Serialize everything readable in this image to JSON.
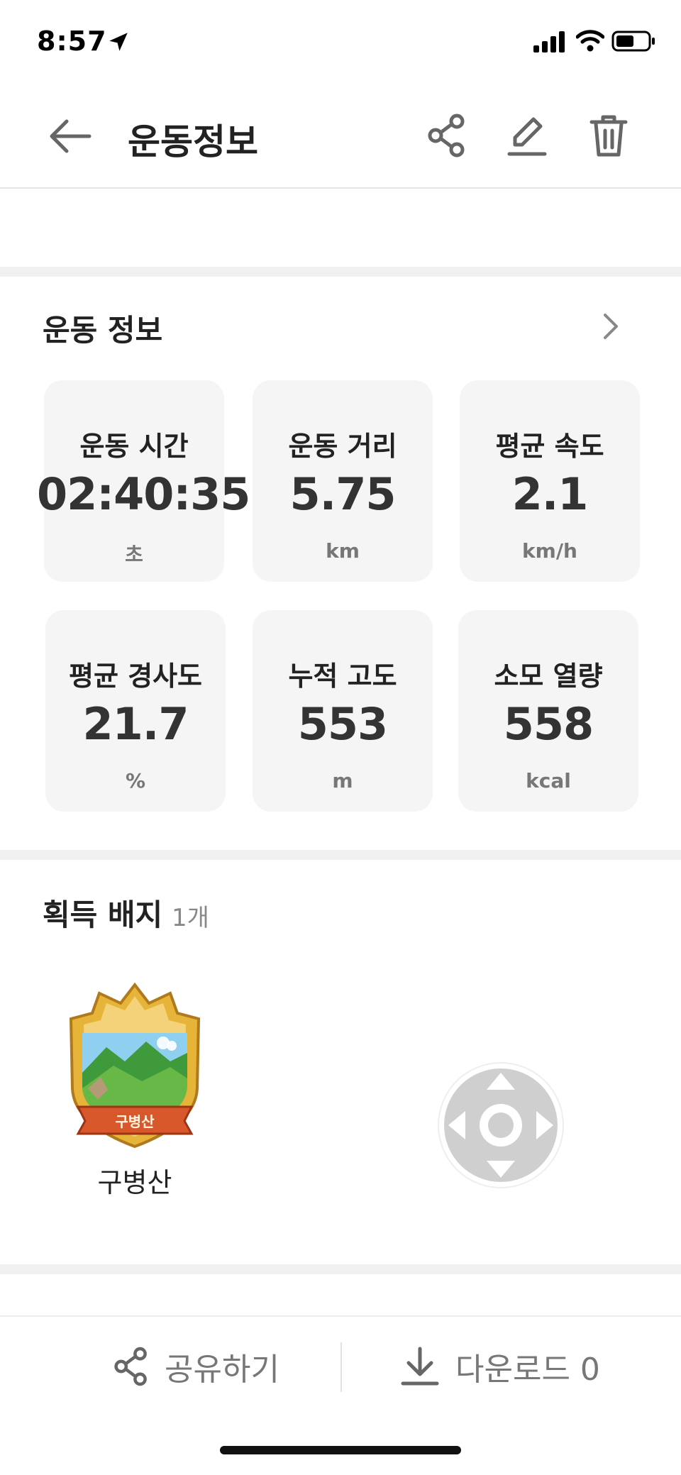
{
  "status_bar": {
    "time": "8:57"
  },
  "header": {
    "title": "운동정보"
  },
  "exercise_section": {
    "title": "운동 정보",
    "stats": [
      {
        "label": "운동 시간",
        "value": "02:40:35",
        "unit": "초"
      },
      {
        "label": "운동 거리",
        "value": "5.75",
        "unit": "km"
      },
      {
        "label": "평균 속도",
        "value": "2.1",
        "unit": "km/h"
      },
      {
        "label": "평균 경사도",
        "value": "21.7",
        "unit": "%"
      },
      {
        "label": "누적 고도",
        "value": "553",
        "unit": "m"
      },
      {
        "label": "소모 열량",
        "value": "558",
        "unit": "kcal"
      }
    ]
  },
  "badges_section": {
    "title": "획득 배지",
    "count": "1개",
    "badges": [
      {
        "name": "구병산",
        "ribbon_text": "구병산"
      }
    ]
  },
  "bottom_bar": {
    "share_label": "공유하기",
    "download_label": "다운로드 0"
  },
  "colors": {
    "card_background": "#f5f5f5",
    "divider": "#f0f0f0",
    "icon_gray": "#666666",
    "badge_gold": "#e7b43a",
    "badge_ribbon": "#d9582b"
  }
}
